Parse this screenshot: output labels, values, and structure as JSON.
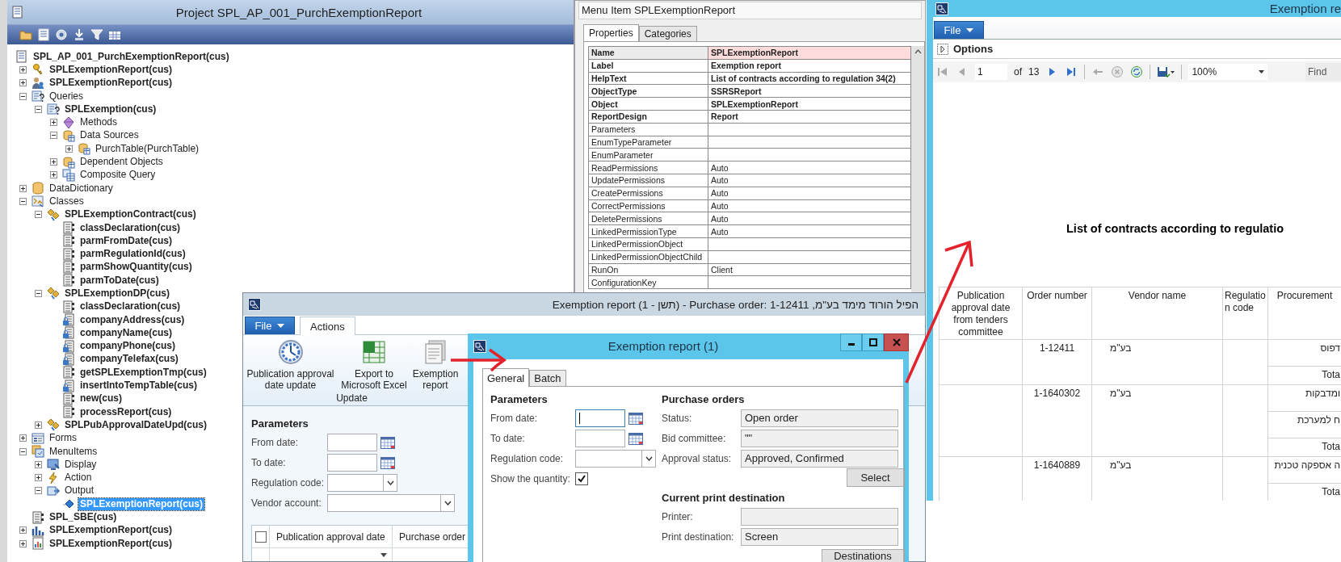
{
  "project_window": {
    "title": "Project SPL_AP_001_PurchExemptionReport",
    "tree": [
      {
        "label": "SPL_AP_001_PurchExemptionReport(cus)",
        "kind": "project",
        "bold": true,
        "selected": false,
        "children": [
          {
            "label": "SPLExemptionReport(cus)",
            "kind": "key",
            "bold": true,
            "selected": false,
            "expanded": false
          },
          {
            "label": "SPLExemptionReport(cus)",
            "kind": "users",
            "bold": true,
            "selected": false,
            "expanded": false
          },
          {
            "label": "Queries",
            "kind": "query",
            "bold": false,
            "selected": false,
            "expanded": true,
            "children": [
              {
                "label": "SPLExemption(cus)",
                "kind": "query",
                "bold": true,
                "selected": false,
                "expanded": true,
                "children": [
                  {
                    "label": "Methods",
                    "kind": "methods",
                    "bold": false,
                    "selected": false,
                    "expanded": false
                  },
                  {
                    "label": "Data Sources",
                    "kind": "datasource",
                    "bold": false,
                    "selected": false,
                    "expanded": true,
                    "children": [
                      {
                        "label": "PurchTable(PurchTable)",
                        "kind": "datasource",
                        "bold": false,
                        "selected": false,
                        "expanded": false
                      }
                    ]
                  },
                  {
                    "label": "Dependent Objects",
                    "kind": "datasource",
                    "bold": false,
                    "selected": false,
                    "expanded": false
                  },
                  {
                    "label": "Composite Query",
                    "kind": "composite",
                    "bold": false,
                    "selected": false,
                    "expanded": false
                  }
                ]
              }
            ]
          },
          {
            "label": "DataDictionary",
            "kind": "database",
            "bold": false,
            "selected": false,
            "expanded": false
          },
          {
            "label": "Classes",
            "kind": "classes",
            "bold": false,
            "selected": false,
            "expanded": true,
            "children": [
              {
                "label": "SPLExemptionContract(cus)",
                "kind": "class",
                "bold": true,
                "selected": false,
                "expanded": true,
                "children": [
                  {
                    "label": "classDeclaration(cus)",
                    "kind": "method",
                    "bold": true,
                    "selected": false
                  },
                  {
                    "label": "parmFromDate(cus)",
                    "kind": "method",
                    "bold": true,
                    "selected": false
                  },
                  {
                    "label": "parmRegulationId(cus)",
                    "kind": "method",
                    "bold": true,
                    "selected": false
                  },
                  {
                    "label": "parmShowQuantity(cus)",
                    "kind": "method",
                    "bold": true,
                    "selected": false
                  },
                  {
                    "label": "parmToDate(cus)",
                    "kind": "method",
                    "bold": true,
                    "selected": false
                  }
                ]
              },
              {
                "label": "SPLExemptionDP(cus)",
                "kind": "class",
                "bold": true,
                "selected": false,
                "expanded": true,
                "children": [
                  {
                    "label": "classDeclaration(cus)",
                    "kind": "method",
                    "bold": true,
                    "selected": false
                  },
                  {
                    "label": "companyAddress(cus)",
                    "kind": "locked_method",
                    "bold": true,
                    "selected": false
                  },
                  {
                    "label": "companyName(cus)",
                    "kind": "locked_method",
                    "bold": true,
                    "selected": false
                  },
                  {
                    "label": "companyPhone(cus)",
                    "kind": "locked_method",
                    "bold": true,
                    "selected": false
                  },
                  {
                    "label": "companyTelefax(cus)",
                    "kind": "locked_method",
                    "bold": true,
                    "selected": false
                  },
                  {
                    "label": "getSPLExemptionTmp(cus)",
                    "kind": "method",
                    "bold": true,
                    "selected": false
                  },
                  {
                    "label": "insertIntoTempTable(cus)",
                    "kind": "locked_method",
                    "bold": true,
                    "selected": false
                  },
                  {
                    "label": "new(cus)",
                    "kind": "method",
                    "bold": true,
                    "selected": false
                  },
                  {
                    "label": "processReport(cus)",
                    "kind": "method",
                    "bold": true,
                    "selected": false
                  }
                ]
              },
              {
                "label": "SPLPubApprovalDateUpd(cus)",
                "kind": "class",
                "bold": true,
                "selected": false,
                "expanded": false
              }
            ]
          },
          {
            "label": "Forms",
            "kind": "forms",
            "bold": false,
            "selected": false,
            "expanded": false
          },
          {
            "label": "MenuItems",
            "kind": "menuitems",
            "bold": false,
            "selected": false,
            "expanded": true,
            "children": [
              {
                "label": "Display",
                "kind": "display",
                "bold": false,
                "selected": false,
                "expanded": false
              },
              {
                "label": "Action",
                "kind": "action",
                "bold": false,
                "selected": false,
                "expanded": false
              },
              {
                "label": "Output",
                "kind": "output",
                "bold": false,
                "selected": false,
                "expanded": true,
                "children": [
                  {
                    "label": "SPLExemptionReport(cus)",
                    "kind": "menuitem",
                    "bold": true,
                    "selected": true
                  }
                ]
              }
            ]
          },
          {
            "label": "SPL_SBE(cus)",
            "kind": "method",
            "bold": true,
            "selected": false
          },
          {
            "label": "SPLExemptionReport(cus)",
            "kind": "chart",
            "bold": true,
            "selected": false,
            "expanded": false
          },
          {
            "label": "SPLExemptionReport(cus)",
            "kind": "report",
            "bold": true,
            "selected": false,
            "expanded": false
          }
        ]
      }
    ]
  },
  "properties_window": {
    "title": "Menu Item SPLExemptionReport",
    "tabs": [
      {
        "label": "Properties",
        "selected": true
      },
      {
        "label": "Categories",
        "selected": false
      }
    ],
    "properties": [
      {
        "name": "Name",
        "value": "SPLExemptionReport",
        "bold": true,
        "highlighted": true
      },
      {
        "name": "Label",
        "value": "Exemption report",
        "bold": true,
        "highlighted": false
      },
      {
        "name": "HelpText",
        "value": "List of contracts according to regulation 34(2)",
        "bold": true,
        "highlighted": false
      },
      {
        "name": "ObjectType",
        "value": "SSRSReport",
        "bold": true,
        "highlighted": false
      },
      {
        "name": "Object",
        "value": "SPLExemptionReport",
        "bold": true,
        "highlighted": false
      },
      {
        "name": "ReportDesign",
        "value": "Report",
        "bold": true,
        "highlighted": false
      },
      {
        "name": "Parameters",
        "bold": false,
        "highlighted": false
      },
      {
        "name": "EnumTypeParameter",
        "bold": false,
        "highlighted": false
      },
      {
        "name": "EnumParameter",
        "bold": false,
        "highlighted": false
      },
      {
        "name": "ReadPermissions",
        "value": "Auto",
        "bold": false,
        "highlighted": false
      },
      {
        "name": "UpdatePermissions",
        "value": "Auto",
        "bold": false,
        "highlighted": false
      },
      {
        "name": "CreatePermissions",
        "value": "Auto",
        "bold": false,
        "highlighted": false
      },
      {
        "name": "CorrectPermissions",
        "value": "Auto",
        "bold": false,
        "highlighted": false
      },
      {
        "name": "DeletePermissions",
        "value": "Auto",
        "bold": false,
        "highlighted": false
      },
      {
        "name": "LinkedPermissionType",
        "value": "Auto",
        "bold": false,
        "highlighted": false
      },
      {
        "name": "LinkedPermissionObject",
        "bold": false,
        "highlighted": false
      },
      {
        "name": "LinkedPermissionObjectChild",
        "bold": false,
        "highlighted": false
      },
      {
        "name": "RunOn",
        "value": "Client",
        "bold": false,
        "highlighted": false
      },
      {
        "name": "ConfigurationKey",
        "bold": false,
        "highlighted": false
      }
    ]
  },
  "purchase_window": {
    "title": "Exemption report (1 - תשן) - Purchase order: 1-12411 ,הפיל הורוד מימד בע\"מ",
    "file_button": "File",
    "tabs": [
      {
        "label": "Actions",
        "selected": true
      }
    ],
    "ribbon": {
      "buttons": [
        {
          "label": "Publication approval date update",
          "kind": "clock"
        },
        {
          "label": "Export to Microsoft Excel",
          "kind": "spreadsheet"
        },
        {
          "label": "Exemption report",
          "kind": "report"
        }
      ],
      "group": "Update"
    },
    "parameters": {
      "heading": "Parameters",
      "fields": [
        {
          "kind": "date",
          "label": "From date:",
          "focused": false
        },
        {
          "kind": "date",
          "label": "To date:",
          "focused": false
        },
        {
          "kind": "combo",
          "label": "Regulation code:"
        },
        {
          "kind": "lookup",
          "label": "Vendor account:"
        }
      ]
    },
    "grid": {
      "select_all": {
        "checked": false
      },
      "columns": [
        "Publication approval date",
        "Purchase order"
      ]
    }
  },
  "dialog": {
    "title": "Exemption report (1)",
    "tabs": [
      {
        "label": "General",
        "selected": true
      },
      {
        "label": "Batch",
        "selected": false
      }
    ],
    "left": {
      "heading": "Parameters",
      "fields": [
        {
          "kind": "date",
          "label": "From date:",
          "focused": true
        },
        {
          "kind": "date",
          "label": "To date:",
          "focused": false
        },
        {
          "kind": "combo",
          "label": "Regulation code:"
        },
        {
          "kind": "checkbox",
          "label": "Show the quantity:",
          "checked": true
        }
      ]
    },
    "right": [
      {
        "heading": "Purchase orders",
        "fields": [
          {
            "kind": "readonly",
            "label": "Status:",
            "value": "Open order"
          },
          {
            "kind": "readonly",
            "label": "Bid committee:",
            "value": "\"\""
          },
          {
            "kind": "readonly",
            "label": "Approval status:",
            "value": "Approved, Confirmed"
          }
        ],
        "button": "Select"
      },
      {
        "heading": "Current print destination",
        "fields": [
          {
            "kind": "readonly",
            "label": "Printer:"
          },
          {
            "kind": "readonly",
            "label": "Print destination:",
            "value": "Screen"
          }
        ],
        "button": "Destinations"
      }
    ]
  },
  "report_window": {
    "title": "Exemption re",
    "file_button": "File",
    "options": "Options",
    "toolbar": {
      "page": "1",
      "of": "of",
      "page_count": "13",
      "zoom": "100%",
      "find": "Find"
    },
    "report": {
      "title": "List of contracts according to regulatio",
      "columns": [
        "Publication approval date from tenders committee",
        "Order number",
        "Vendor name",
        "Regulation code",
        "Procurement"
      ],
      "rows": [
        {
          "order_number": "1-12411",
          "vendor_name": "בע\"מ",
          "procurement": [
            "דפוס",
            "Tota"
          ]
        },
        {
          "order_number": "1-1640302",
          "vendor_name": "בע\"מ",
          "procurement": [
            "ומדבקות",
            "ח למערכת",
            "Tota"
          ]
        },
        {
          "order_number": "1-1640889",
          "vendor_name": "בע\"מ",
          "procurement": [
            "ה אספקה טכנית",
            "Tota"
          ]
        }
      ]
    }
  }
}
